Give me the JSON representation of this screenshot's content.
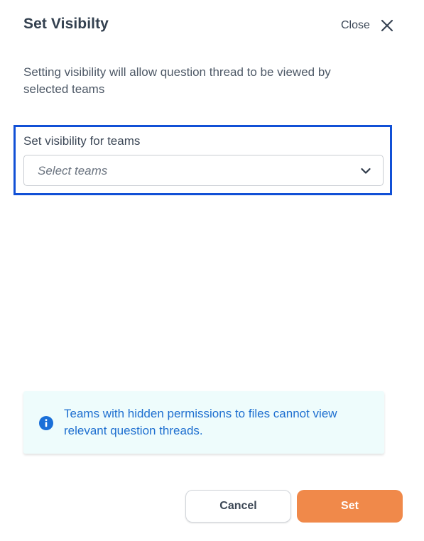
{
  "dialog": {
    "title": "Set Visibilty",
    "close_label": "Close",
    "description": "Setting visibility will allow question thread to be viewed by selected teams"
  },
  "field": {
    "label": "Set visibility for teams",
    "placeholder": "Select teams"
  },
  "info": {
    "message": "Teams with hidden permissions to files cannot view relevant question threads.",
    "icon": "info-icon"
  },
  "actions": {
    "cancel_label": "Cancel",
    "set_label": "Set"
  },
  "colors": {
    "primary": "#f0894a",
    "focus": "#1150d6",
    "info_text": "#1e6fd0",
    "info_bg": "#eefcfc"
  }
}
